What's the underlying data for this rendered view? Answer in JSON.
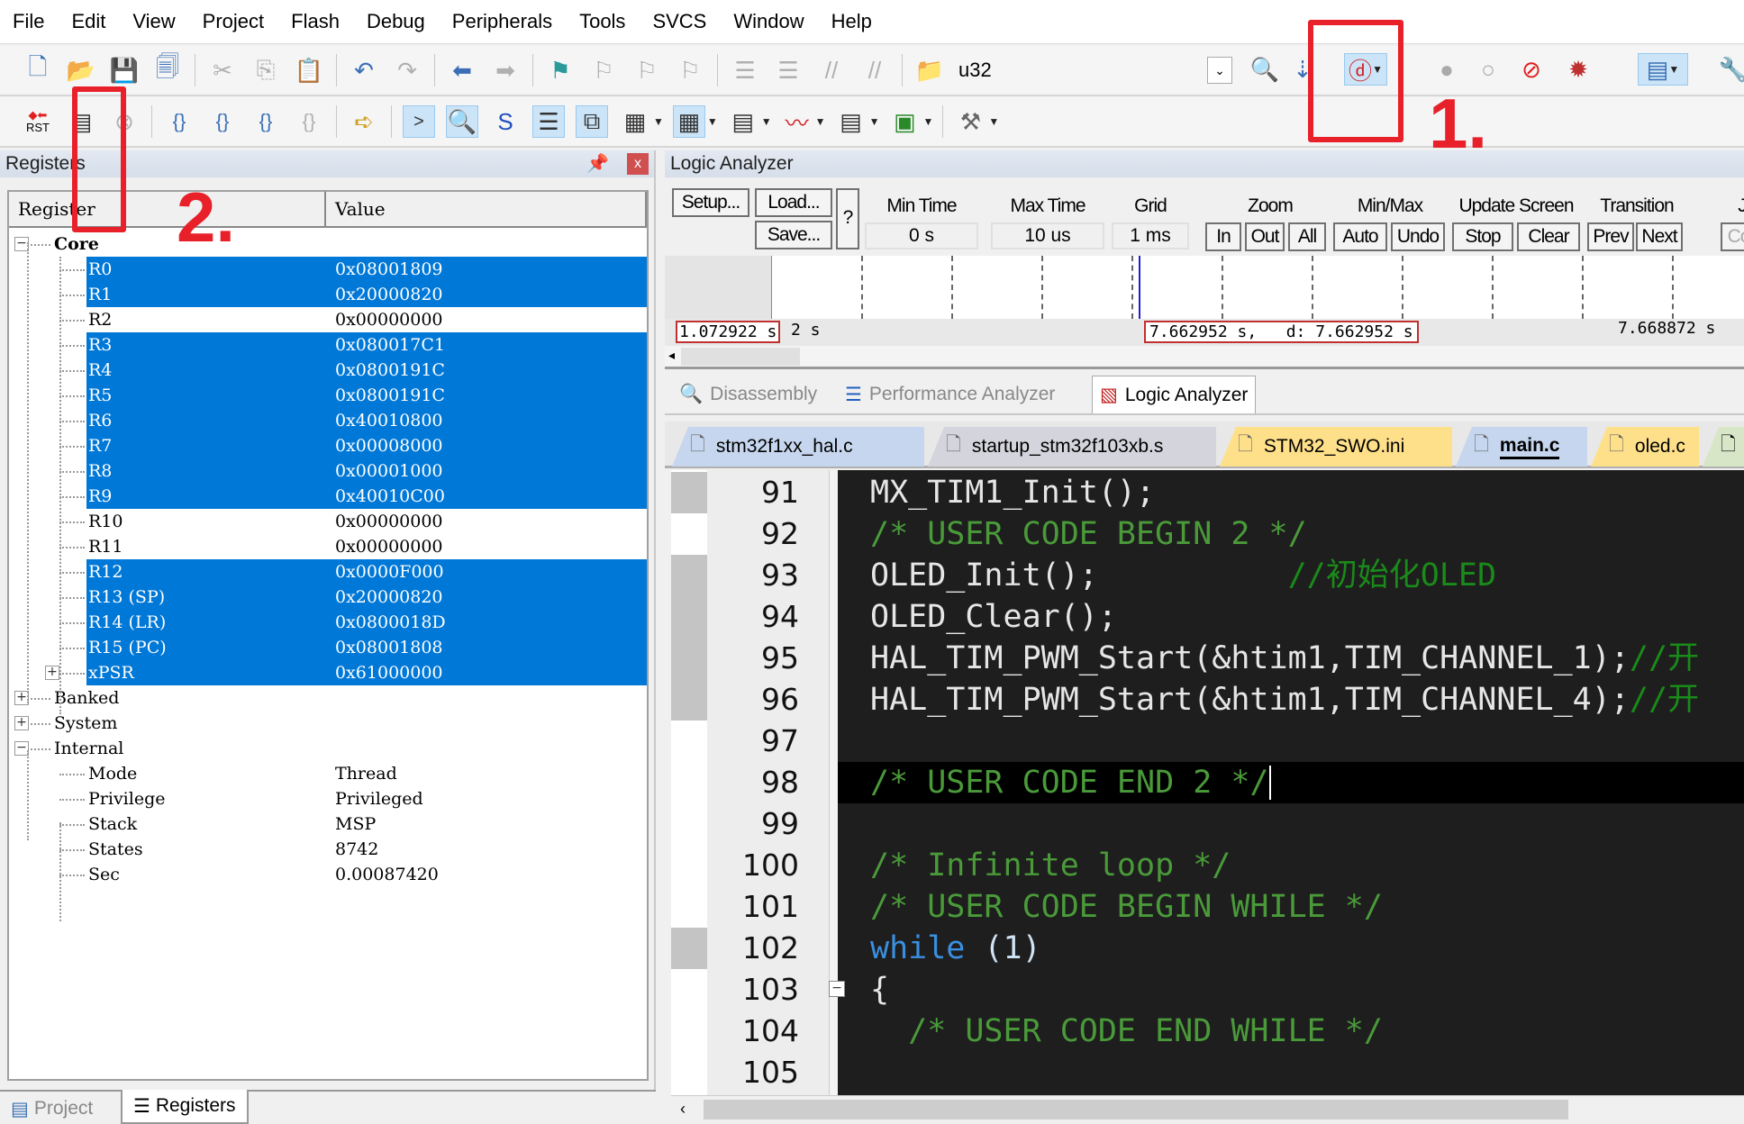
{
  "menu": [
    "File",
    "Edit",
    "View",
    "Project",
    "Flash",
    "Debug",
    "Peripherals",
    "Tools",
    "SVCS",
    "Window",
    "Help"
  ],
  "toolbar": {
    "target_name": "u32",
    "rst_label": "RST"
  },
  "registers": {
    "title": "Registers",
    "columns": [
      "Register",
      "Value"
    ],
    "rows": [
      {
        "name": "Core",
        "value": "",
        "level": 0,
        "toggle": "-",
        "bold": true
      },
      {
        "name": "R0",
        "value": "0x08001809",
        "level": 2,
        "selected": true
      },
      {
        "name": "R1",
        "value": "0x20000820",
        "level": 2,
        "selected": true
      },
      {
        "name": "R2",
        "value": "0x00000000",
        "level": 2
      },
      {
        "name": "R3",
        "value": "0x080017C1",
        "level": 2,
        "selected": true
      },
      {
        "name": "R4",
        "value": "0x0800191C",
        "level": 2,
        "selected": true
      },
      {
        "name": "R5",
        "value": "0x0800191C",
        "level": 2,
        "selected": true
      },
      {
        "name": "R6",
        "value": "0x40010800",
        "level": 2,
        "selected": true
      },
      {
        "name": "R7",
        "value": "0x00008000",
        "level": 2,
        "selected": true
      },
      {
        "name": "R8",
        "value": "0x00001000",
        "level": 2,
        "selected": true
      },
      {
        "name": "R9",
        "value": "0x40010C00",
        "level": 2,
        "selected": true
      },
      {
        "name": "R10",
        "value": "0x00000000",
        "level": 2
      },
      {
        "name": "R11",
        "value": "0x00000000",
        "level": 2
      },
      {
        "name": "R12",
        "value": "0x0000F000",
        "level": 2,
        "selected": true
      },
      {
        "name": "R13 (SP)",
        "value": "0x20000820",
        "level": 2,
        "selected": true
      },
      {
        "name": "R14 (LR)",
        "value": "0x0800018D",
        "level": 2,
        "selected": true
      },
      {
        "name": "R15 (PC)",
        "value": "0x08001808",
        "level": 2,
        "selected": true
      },
      {
        "name": "xPSR",
        "value": "0x61000000",
        "level": 2,
        "selected": true,
        "toggle": "+"
      },
      {
        "name": "Banked",
        "value": "",
        "level": 0,
        "toggle": "+"
      },
      {
        "name": "System",
        "value": "",
        "level": 0,
        "toggle": "+"
      },
      {
        "name": "Internal",
        "value": "",
        "level": 0,
        "toggle": "-"
      },
      {
        "name": "Mode",
        "value": "Thread",
        "level": 2
      },
      {
        "name": "Privilege",
        "value": "Privileged",
        "level": 2
      },
      {
        "name": "Stack",
        "value": "MSP",
        "level": 2
      },
      {
        "name": "States",
        "value": "8742",
        "level": 2
      },
      {
        "name": "Sec",
        "value": "0.00087420",
        "level": 2
      }
    ]
  },
  "bottom_tabs": [
    {
      "label": "Project"
    },
    {
      "label": "Registers",
      "active": true
    }
  ],
  "logic_analyzer": {
    "title": "Logic Analyzer",
    "setup": "Setup...",
    "load": "Load...",
    "save": "Save...",
    "help": "?",
    "min_time_label": "Min Time",
    "min_time": "0 s",
    "max_time_label": "Max Time",
    "max_time": "10 us",
    "grid_label": "Grid",
    "grid": "1 ms",
    "zoom_label": "Zoom",
    "zoom_in": "In",
    "zoom_out": "Out",
    "zoom_all": "All",
    "minmax_label": "Min/Max",
    "auto": "Auto",
    "undo": "Undo",
    "update_label": "Update Screen",
    "stop": "Stop",
    "clear": "Clear",
    "transition_label": "Transition",
    "prev": "Prev",
    "next": "Next",
    "cut_label": "J",
    "cut_btn": "Co",
    "time_left": "1.072922 s",
    "time_left_tail": "2 s",
    "time_cursor": "7.662952 s,   d: 7.662952 s",
    "time_right": "7.668872 s"
  },
  "window_tabs": [
    {
      "label": "Disassembly"
    },
    {
      "label": "Performance Analyzer"
    },
    {
      "label": "Logic Analyzer",
      "active": true
    }
  ],
  "file_tabs": [
    {
      "label": "stm32f1xx_hal.c",
      "color": "#c6d6ee"
    },
    {
      "label": "startup_stm32f103xb.s",
      "color": "#d4d4dc"
    },
    {
      "label": "STM32_SWO.ini",
      "color": "#ffe08a"
    },
    {
      "label": "main.c",
      "color": "#c6d6ee",
      "active": true
    },
    {
      "label": "oled.c",
      "color": "#ffe08a"
    }
  ],
  "code": [
    {
      "n": "91",
      "mark": true,
      "t": [
        [
          "MX_TIM1_Init();",
          "#e6e6e6"
        ]
      ]
    },
    {
      "n": "92",
      "t": [
        [
          "/* USER CODE BEGIN 2 */",
          "#4a9a3a"
        ]
      ]
    },
    {
      "n": "93",
      "mark": true,
      "t": [
        [
          "OLED_Init();          ",
          "#e6e6e6"
        ],
        [
          "//初始化OLED",
          "#1a8a1a"
        ]
      ]
    },
    {
      "n": "94",
      "mark": true,
      "t": [
        [
          "OLED_Clear();",
          "#e6e6e6"
        ]
      ]
    },
    {
      "n": "95",
      "mark": true,
      "t": [
        [
          "HAL_TIM_PWM_Start(&htim1,TIM_CHANNEL_1);",
          "#e6e6e6"
        ],
        [
          "//开",
          "#1a8a1a"
        ]
      ]
    },
    {
      "n": "96",
      "mark": true,
      "t": [
        [
          "HAL_TIM_PWM_Start(&htim1,TIM_CHANNEL_4);",
          "#e6e6e6"
        ],
        [
          "//开",
          "#1a8a1a"
        ]
      ]
    },
    {
      "n": "97",
      "t": []
    },
    {
      "n": "98",
      "current": true,
      "t": [
        [
          "/* USER CODE END 2 */",
          "#4a9a3a"
        ]
      ]
    },
    {
      "n": "99",
      "t": []
    },
    {
      "n": "100",
      "t": [
        [
          "/* Infinite loop */",
          "#4a9a3a"
        ]
      ]
    },
    {
      "n": "101",
      "t": [
        [
          "/* USER CODE BEGIN WHILE */",
          "#4a9a3a"
        ]
      ]
    },
    {
      "n": "102",
      "mark": true,
      "t": [
        [
          "while",
          "#3a8fe0"
        ],
        [
          " (1)",
          "#cfe3f5"
        ]
      ]
    },
    {
      "n": "103",
      "fold": true,
      "t": [
        [
          "{",
          "#e6e6e6"
        ]
      ]
    },
    {
      "n": "104",
      "t": [
        [
          "  /* USER CODE END WHILE */",
          "#4a9a3a"
        ]
      ]
    },
    {
      "n": "105",
      "t": []
    }
  ],
  "annotations": {
    "one": "1.",
    "two": "2."
  },
  "colors": {
    "selection": "#0078d7",
    "annotation": "#e8202a",
    "editor_bg": "#1e1e1e"
  }
}
